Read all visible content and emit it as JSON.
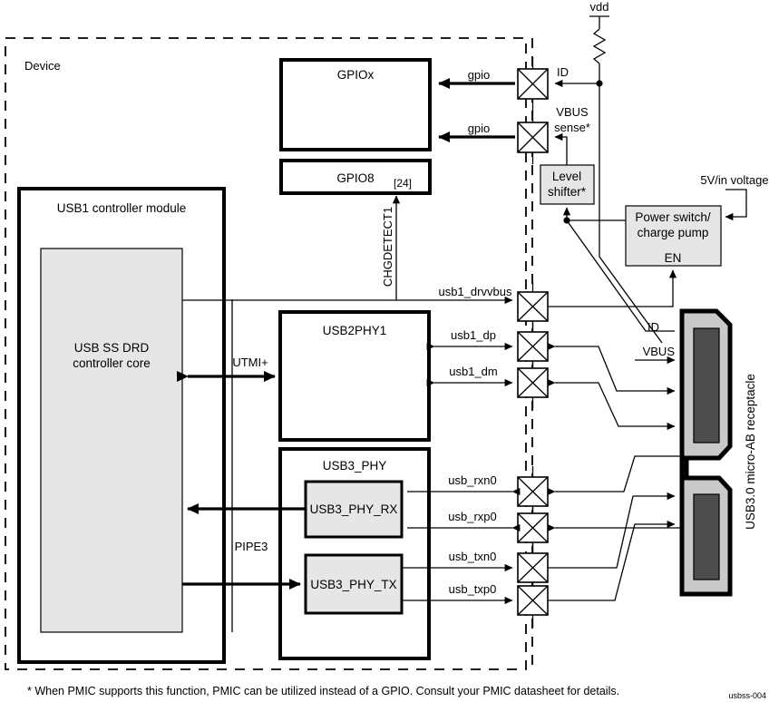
{
  "figure": {
    "id_tag": "usbss-004",
    "footnote": "* When PMIC supports this function, PMIC can be utilized instead of a GPIO. Consult your PMIC datasheet for details."
  },
  "boundary": {
    "label": "Device"
  },
  "blocks": {
    "gpiox": {
      "label": "GPIOx"
    },
    "gpio8": {
      "label": "GPIO8",
      "bit": "[24]"
    },
    "usb1_module": {
      "label": "USB1 controller module"
    },
    "drd_core": {
      "label_line1": "USB SS DRD",
      "label_line2": "controller core"
    },
    "usb2phy1": {
      "label": "USB2PHY1"
    },
    "usb3phy": {
      "label": "USB3_PHY"
    },
    "usb3phy_rx": {
      "label": "USB3_PHY_RX"
    },
    "usb3phy_tx": {
      "label": "USB3_PHY_TX"
    },
    "level_shifter": {
      "label_line1": "Level",
      "label_line2": "shifter*"
    },
    "power_switch": {
      "label_line1": "Power switch/",
      "label_line2": "charge pump",
      "enable_label": "EN"
    },
    "receptacle": {
      "label": "USB3.0 micro-AB receptacle"
    }
  },
  "nets": {
    "vdd": "vdd",
    "id_top": "ID",
    "gpio_top": "gpio",
    "gpio_bottom": "gpio",
    "vbus_sense_line1": "VBUS",
    "vbus_sense_line2": "sense*",
    "chgdetect1": "CHGDETECT1",
    "five_volt_in": "5V/in voltage",
    "usb1_drvvbus": "usb1_drvvbus",
    "usb1_dp": "usb1_dp",
    "usb1_dm": "usb1_dm",
    "usb_rxn0": "usb_rxn0",
    "usb_rxp0": "usb_rxp0",
    "usb_txn0": "usb_txn0",
    "usb_txp0": "usb_txp0",
    "utmi": "UTMI+",
    "pipe3": "PIPE3",
    "recp_id": "ID",
    "recp_vbus": "VBUS"
  },
  "colors": {
    "background": "#ffffff",
    "line": "#000000",
    "block_fill": "#ffffff",
    "subblock_fill": "#e6e6e6",
    "receptacle_body": "#c9c9c9",
    "receptacle_slot": "#4d4d4d"
  }
}
